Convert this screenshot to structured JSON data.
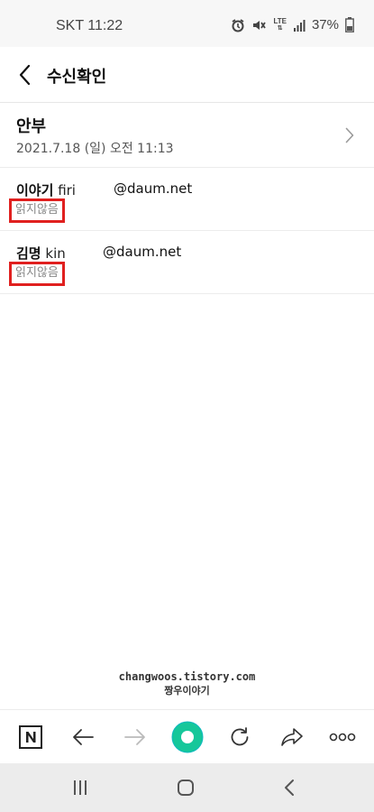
{
  "status_bar": {
    "carrier_time": "SKT 11:22",
    "network": "LTE",
    "battery": "37%",
    "icons": [
      "alarm-icon",
      "mute-icon",
      "lte-icon",
      "signal-icon",
      "battery-icon"
    ]
  },
  "header": {
    "title": "수신확인",
    "back_icon": "chevron-left-icon"
  },
  "mail": {
    "subject": "안부",
    "date": "2021.7.18 (일) 오전 11:13"
  },
  "recipients": [
    {
      "name": "이야기",
      "first": "firi",
      "email": "@daum.net",
      "status": "읽지않음"
    },
    {
      "name": "김명",
      "first": "kin",
      "email": "@daum.net",
      "status": "읽지않음"
    }
  ],
  "watermark": {
    "line1": "changwoos.tistory.com",
    "line2": "짱우이야기"
  },
  "toolbar": {
    "items": [
      "naver-home-icon",
      "back-arrow-icon",
      "forward-arrow-icon",
      "green-dot-icon",
      "refresh-icon",
      "share-icon",
      "more-icon"
    ]
  },
  "nav_bar": {
    "items": [
      "recent-apps-icon",
      "home-icon",
      "back-icon"
    ]
  },
  "colors": {
    "highlight": "#e0201f",
    "accent": "#16c79a"
  }
}
